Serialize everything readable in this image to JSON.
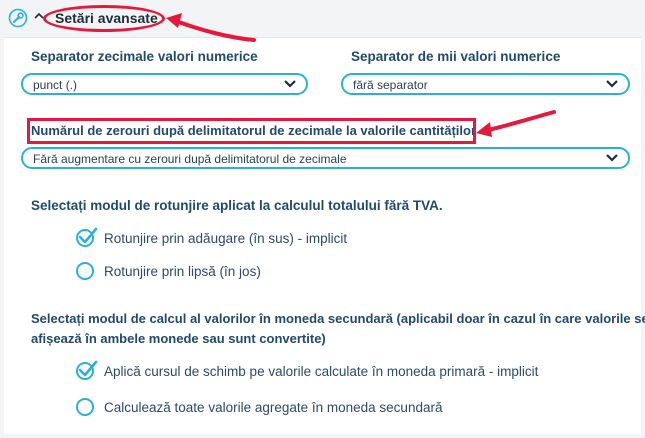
{
  "header": {
    "title": "Setări avansate",
    "icon": "wrench-icon"
  },
  "decimal_separator": {
    "label": "Separator zecimale valori numerice",
    "value": "punct (.)"
  },
  "thousands_separator": {
    "label": "Separator de mii valori numerice",
    "value": "fără separator"
  },
  "zeros_setting": {
    "label": "Numărul de zerouri după delimitatorul de zecimale la valorile cantităților",
    "value": "Fără augmentare cu zerouri după delimitatorul de zecimale"
  },
  "rounding": {
    "question": "Selectați modul de rotunjire aplicat la calculul totalului fără TVA.",
    "options": [
      {
        "label": "Rotunjire prin adăugare (în sus) - implicit",
        "selected": true
      },
      {
        "label": "Rotunjire prin lipsă (în jos)",
        "selected": false
      }
    ]
  },
  "secondary_currency": {
    "question_line1": "Selectați modul de calcul al valorilor în moneda secundară (aplicabil doar în cazul în care valorile se",
    "question_line2": "afișează în ambele monede sau sunt convertite)",
    "options": [
      {
        "label": "Aplică cursul de schimb pe valorile calculate în moneda primară - implicit",
        "selected": true
      },
      {
        "label": "Calculează toate valorile agregate în moneda secundară",
        "selected": false
      }
    ]
  },
  "colors": {
    "accent": "#2bb0d6",
    "annotation": "#e4193d",
    "heading": "#234a6c"
  }
}
